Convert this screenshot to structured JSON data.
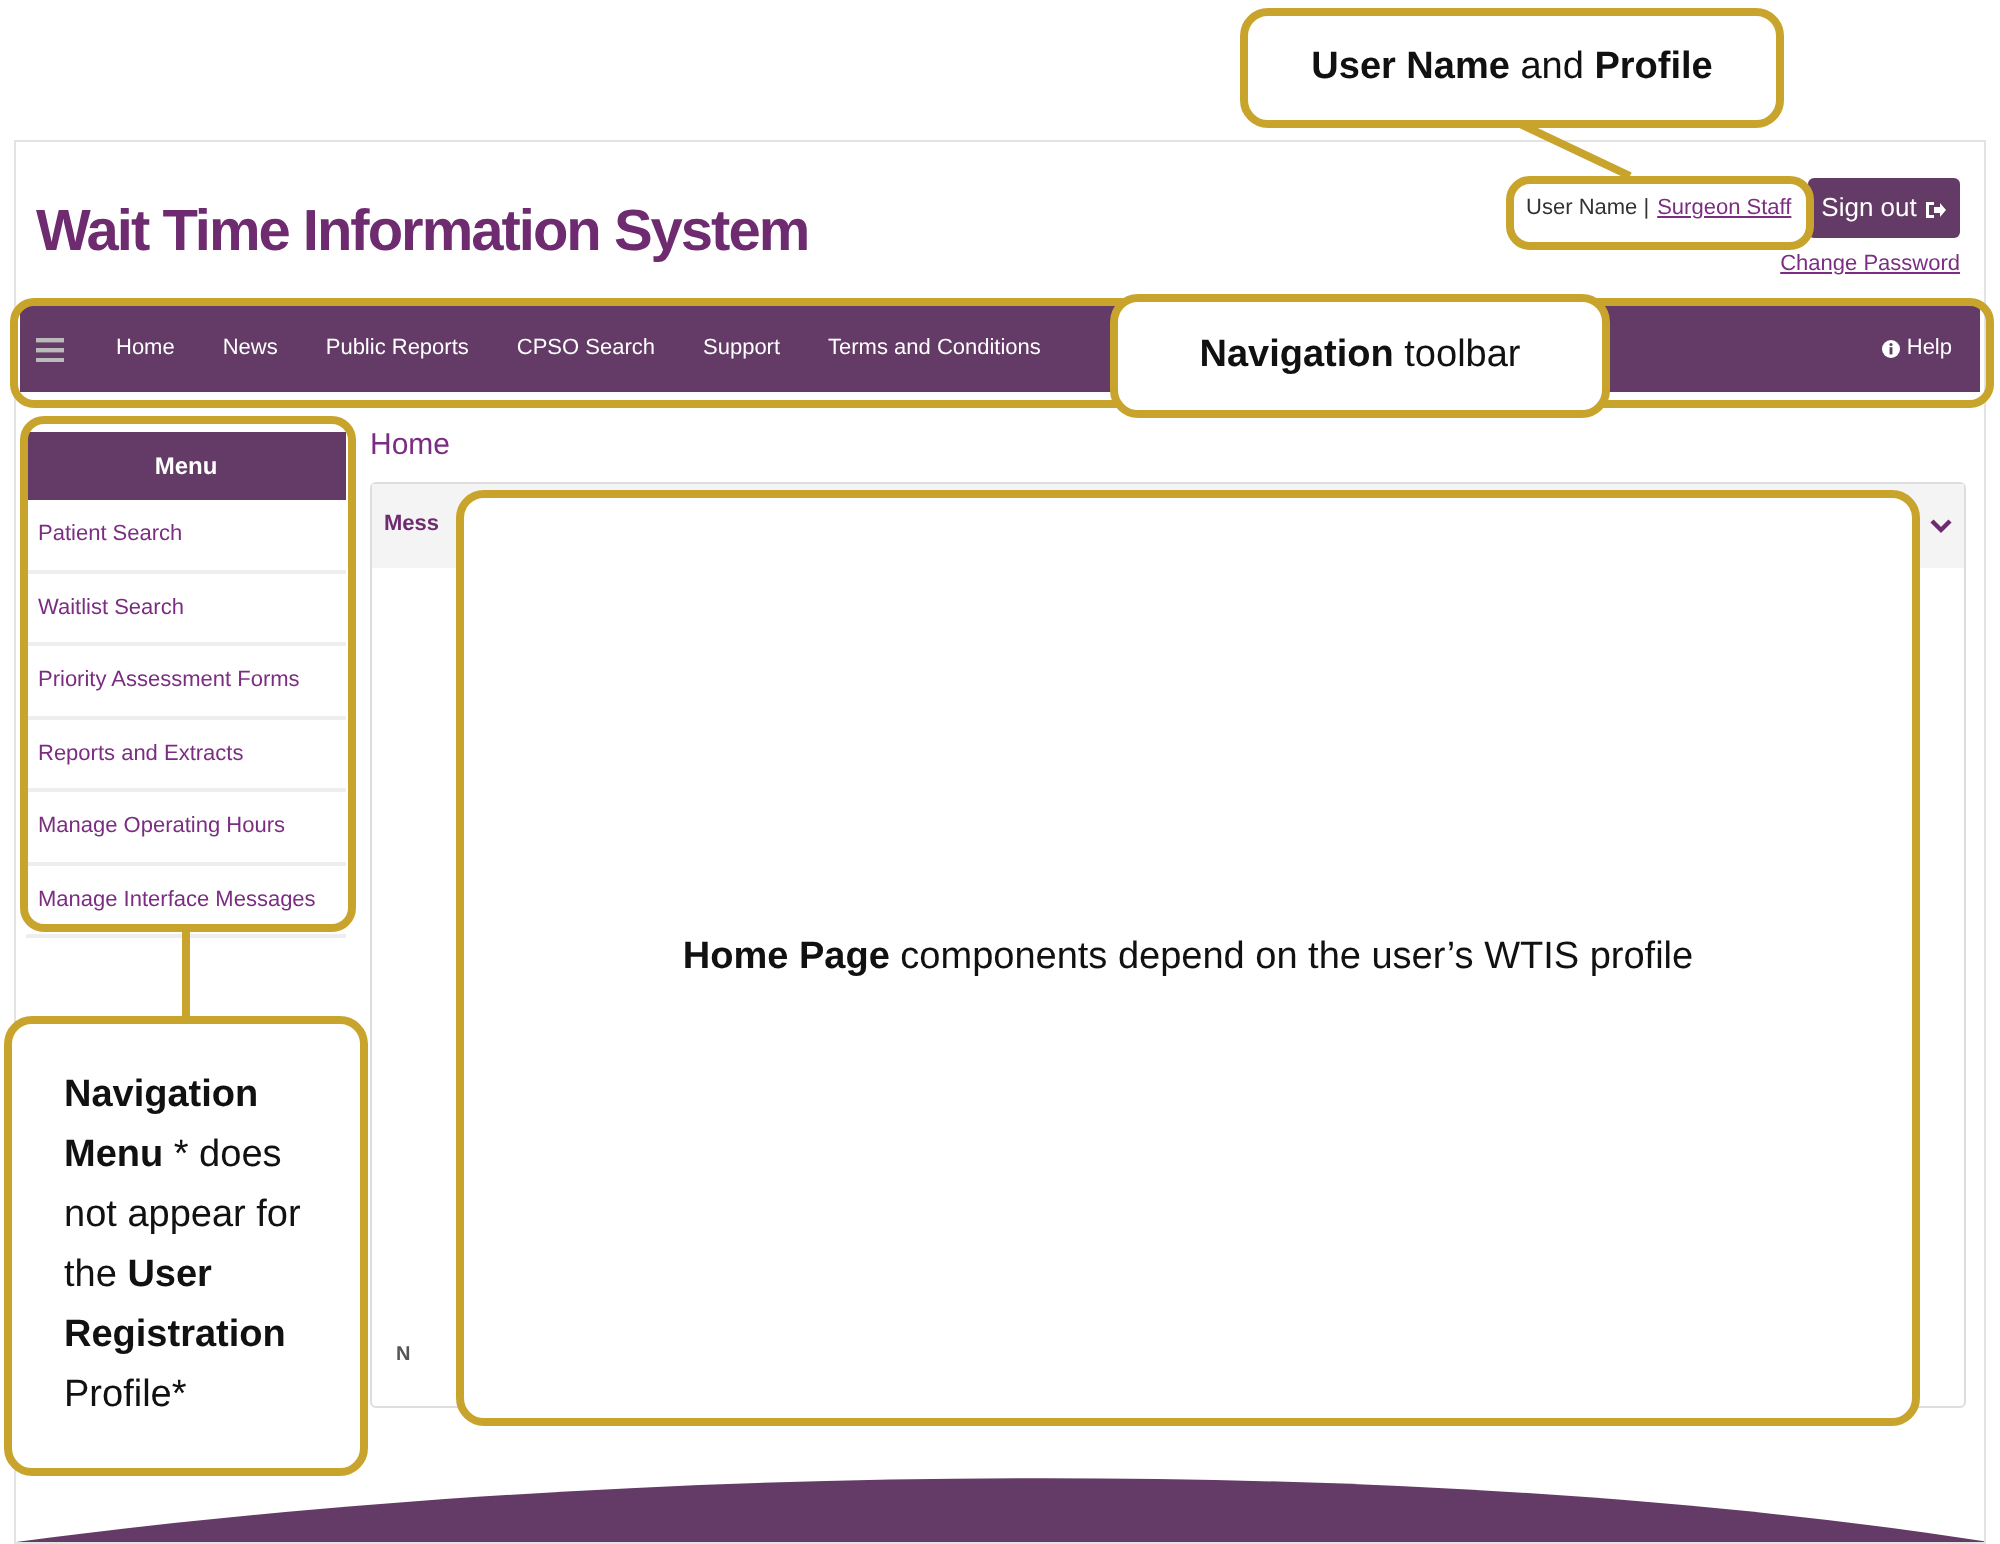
{
  "header": {
    "title": "Wait Time Information System",
    "user_label": "User Name |",
    "user_link": "Surgeon Staff",
    "sign_out": "Sign out",
    "change_password": "Change Password"
  },
  "navbar": {
    "items": [
      {
        "label": "Home"
      },
      {
        "label": "News"
      },
      {
        "label": "Public Reports"
      },
      {
        "label": "CPSO Search"
      },
      {
        "label": "Support"
      },
      {
        "label": "Terms and Conditions"
      }
    ],
    "help": "Help"
  },
  "menu": {
    "title": "Menu",
    "items": [
      {
        "label": "Patient Search"
      },
      {
        "label": "Waitlist Search"
      },
      {
        "label": "Priority Assessment Forms"
      },
      {
        "label": "Reports and Extracts"
      },
      {
        "label": "Manage Operating Hours"
      },
      {
        "label": "Manage Interface Messages"
      }
    ]
  },
  "content": {
    "title": "Home",
    "panel_header": "Mess",
    "footer_text": "N"
  },
  "callouts": [
    {
      "kind": "user",
      "text": "**User Name** and **Profile**"
    },
    {
      "kind": "toolbar",
      "text": "**Navigation** toolbar"
    },
    {
      "kind": "home",
      "text": "**Home Page** components depend on the user’s WTIS profile"
    },
    {
      "kind": "menu",
      "text": "**Navigation Menu** * does not appear for the **User Registration** Profile*"
    }
  ]
}
